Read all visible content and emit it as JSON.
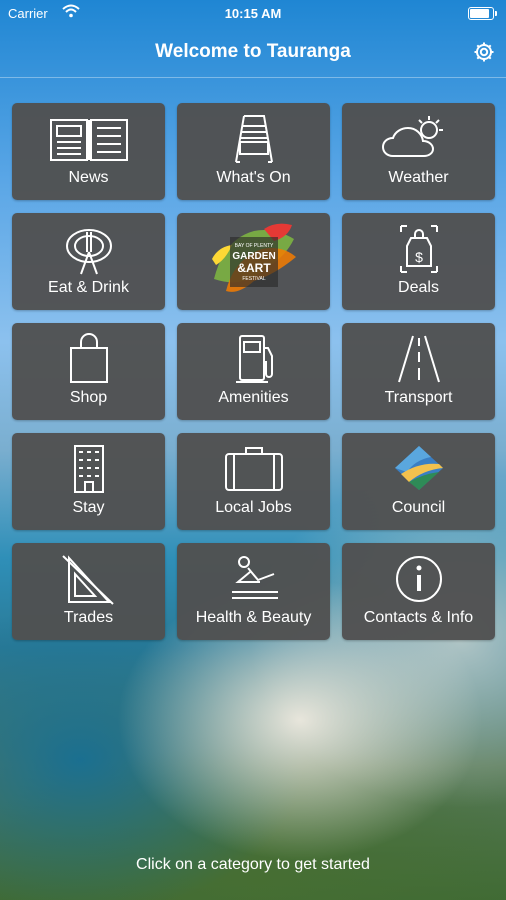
{
  "status": {
    "carrier": "Carrier",
    "time": "10:15 AM",
    "battery_level": 1.0
  },
  "header": {
    "title": "Welcome to Tauranga"
  },
  "tiles": [
    {
      "label": "News",
      "icon": "newspaper-icon"
    },
    {
      "label": "What's On",
      "icon": "a-frame-sign-icon"
    },
    {
      "label": "Weather",
      "icon": "weather-icon"
    },
    {
      "label": "Eat & Drink",
      "icon": "plate-cutlery-icon"
    },
    {
      "label": "",
      "icon": "garden-art-festival-logo",
      "logo_text": [
        "BAY OF PLENTY",
        "GARDEN",
        "&ART",
        "FESTIVAL"
      ]
    },
    {
      "label": "Deals",
      "icon": "deals-tag-icon"
    },
    {
      "label": "Shop",
      "icon": "shopping-bag-icon"
    },
    {
      "label": "Amenities",
      "icon": "fuel-pump-icon"
    },
    {
      "label": "Transport",
      "icon": "road-icon"
    },
    {
      "label": "Stay",
      "icon": "building-icon"
    },
    {
      "label": "Local Jobs",
      "icon": "briefcase-icon"
    },
    {
      "label": "Council",
      "icon": "council-logo"
    },
    {
      "label": "Trades",
      "icon": "set-square-icon"
    },
    {
      "label": "Health & Beauty",
      "icon": "spa-recline-icon"
    },
    {
      "label": "Contacts & Info",
      "icon": "info-icon"
    }
  ],
  "footer": {
    "text": "Click on a category to get started"
  }
}
